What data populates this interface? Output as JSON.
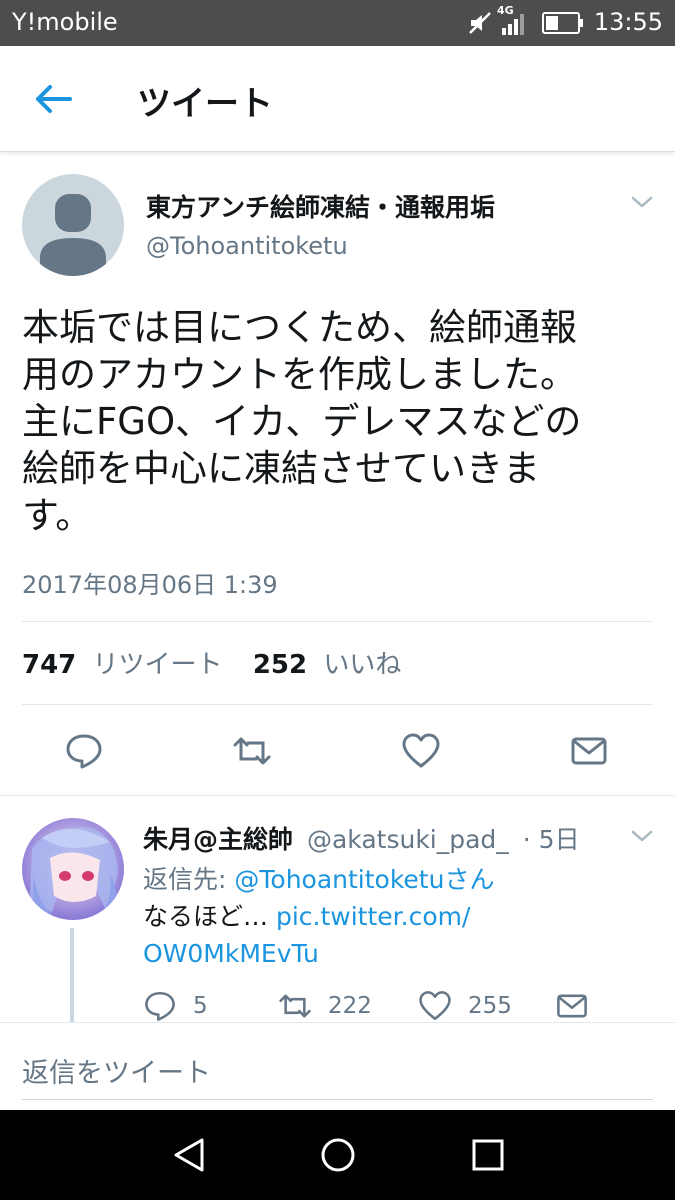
{
  "status_bar": {
    "carrier": "Y!mobile",
    "network": "4G",
    "time": "13:55"
  },
  "app_bar": {
    "title": "ツイート"
  },
  "tweet": {
    "author_name": "東方アンチ絵師凍結・通報用垢",
    "author_handle": "@Tohoantitoketu",
    "text_lines": [
      "本垢では目につくため、絵師通報",
      "用のアカウントを作成しました。",
      "主にFGO、イカ、デレマスなどの",
      "絵師を中心に凍結させていきま",
      "す。"
    ],
    "timestamp": "2017年08月06日 1:39",
    "retweet_count": "747",
    "retweet_label": "リツイート",
    "like_count": "252",
    "like_label": "いいね"
  },
  "reply": {
    "author_name": "朱月@主総帥",
    "author_handle": "@akatsuki_pad_",
    "time_ago": "· 5日",
    "reply_to_prefix": "返信先: ",
    "reply_to_handle": "@Tohoantitoketuさん",
    "body_text": "なるほど… ",
    "link_part1": "pic.twitter.com/",
    "link_part2": "OW0MkMEvTu",
    "reply_count": "5",
    "retweet_count": "222",
    "like_count": "255"
  },
  "compose": {
    "placeholder": "返信をツイート"
  },
  "colors": {
    "accent": "#1b95e0",
    "secondary_text": "#657786",
    "status_bar": "#4b4d4f"
  }
}
